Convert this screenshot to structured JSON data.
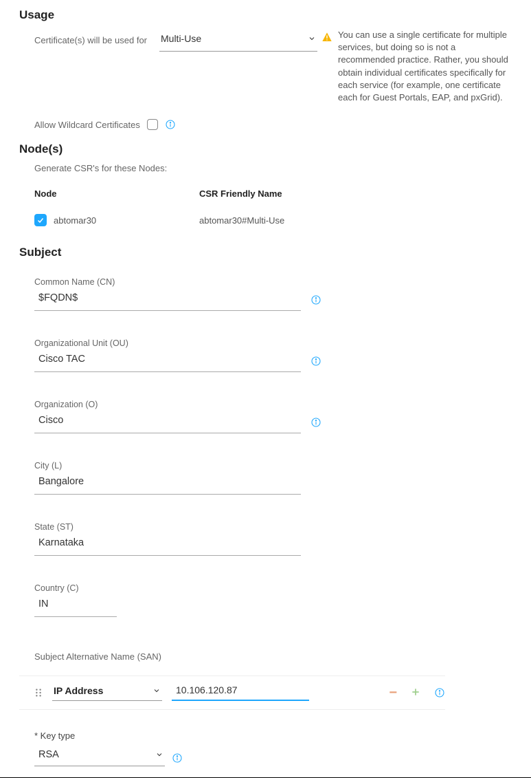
{
  "usage": {
    "heading": "Usage",
    "label": "Certificate(s) will be used for",
    "selected": "Multi-Use",
    "help_text": "You can use a single certificate for multiple services, but doing so is not a recommended practice. Rather, you should obtain individual certificates specifically for each service (for example, one certificate each for Guest Portals, EAP, and pxGrid).",
    "wildcard_label": "Allow Wildcard Certificates"
  },
  "nodes": {
    "heading": "Node(s)",
    "desc": "Generate CSR's for these Nodes:",
    "headers": {
      "node": "Node",
      "csr": "CSR Friendly Name"
    },
    "rows": [
      {
        "name": "abtomar30",
        "csr": "abtomar30#Multi-Use",
        "checked": true
      }
    ]
  },
  "subject": {
    "heading": "Subject",
    "cn": {
      "label": "Common Name (CN)",
      "value": "$FQDN$"
    },
    "ou": {
      "label": "Organizational Unit (OU)",
      "value": "Cisco TAC"
    },
    "o": {
      "label": "Organization (O)",
      "value": "Cisco"
    },
    "l": {
      "label": "City (L)",
      "value": "Bangalore"
    },
    "st": {
      "label": "State (ST)",
      "value": "Karnataka"
    },
    "c": {
      "label": "Country (C)",
      "value": "IN"
    }
  },
  "san": {
    "label": "Subject Alternative Name (SAN)",
    "type": "IP Address",
    "value": "10.106.120.87"
  },
  "keytype": {
    "label": "* Key type",
    "value": "RSA"
  }
}
